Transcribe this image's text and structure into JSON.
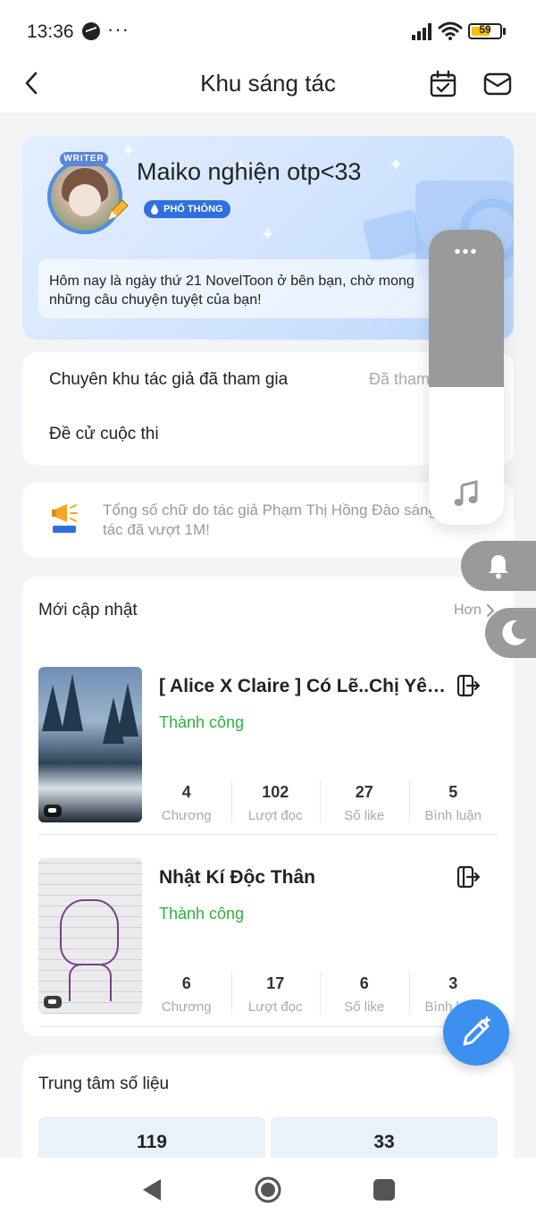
{
  "status_bar": {
    "time": "13:36",
    "dots": "···",
    "battery": "59"
  },
  "header": {
    "title": "Khu sáng tác"
  },
  "profile": {
    "writer_badge": "WRITER",
    "username": "Maiko nghiện otp<33",
    "tier": "PHỔ THÔNG",
    "greeting": "Hôm nay là ngày thứ 21 NovelToon ở bên bạn, chờ mong những câu chuyện tuyệt của bạn!"
  },
  "info": {
    "rows": [
      {
        "label": "Chuyên khu tác giả đã tham gia",
        "value": "Đã tham gia"
      },
      {
        "label": "Đề cử cuộc thi",
        "value": ""
      }
    ]
  },
  "announcement": {
    "text": "Tổng số chữ do tác giả Phạm Thị Hồng Đào sáng tác đã vượt 1M!"
  },
  "updates": {
    "title": "Mới cập nhật",
    "more": "Hơn",
    "books": [
      {
        "title": "[ Alice X Claire ] Có Lẽ..Chị Yêu Em",
        "status": "Thành công",
        "stats": [
          {
            "value": "4",
            "label": "Chương"
          },
          {
            "value": "102",
            "label": "Lượt đọc"
          },
          {
            "value": "27",
            "label": "Số like"
          },
          {
            "value": "5",
            "label": "Bình luận"
          }
        ]
      },
      {
        "title": "Nhật Kí Độc Thân",
        "status": "Thành công",
        "stats": [
          {
            "value": "6",
            "label": "Chương"
          },
          {
            "value": "17",
            "label": "Lượt đọc"
          },
          {
            "value": "6",
            "label": "Số like"
          },
          {
            "value": "3",
            "label": "Bình luận"
          }
        ]
      }
    ]
  },
  "data_center": {
    "title": "Trung tâm số liệu",
    "values": [
      "119",
      "33"
    ]
  },
  "side_panel": {
    "dots": "•••"
  },
  "colors": {
    "accent": "#3d8ff0",
    "success": "#2fb13c",
    "tier_badge": "#2f6fe0",
    "panel_gray": "#9a9a9a"
  },
  "icons": [
    "back-icon",
    "calendar-icon",
    "mail-icon",
    "megaphone-icon",
    "share-icon",
    "music-icon",
    "bell-icon",
    "moon-icon",
    "pen-icon"
  ]
}
